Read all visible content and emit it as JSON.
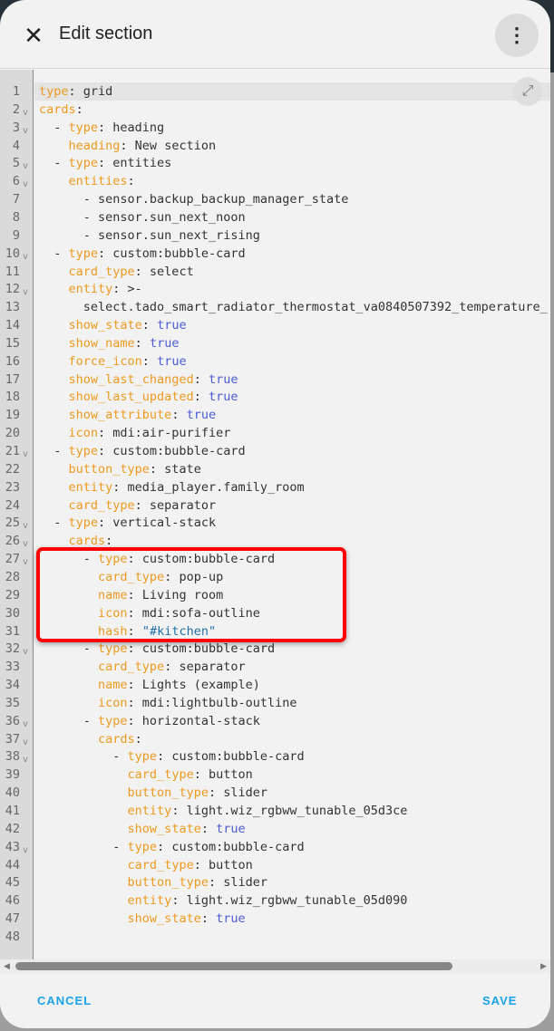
{
  "header": {
    "title": "Edit section",
    "close_icon": "close-icon",
    "menu_icon": "dots-vertical-icon"
  },
  "editor": {
    "expand_icon": "fullscreen-icon",
    "lines": [
      {
        "n": "1",
        "fold": false,
        "parts": [
          [
            "k",
            "type"
          ],
          [
            "",
            ": grid"
          ]
        ]
      },
      {
        "n": "2",
        "fold": true,
        "parts": [
          [
            "k",
            "cards"
          ],
          [
            "",
            ":"
          ]
        ]
      },
      {
        "n": "3",
        "fold": true,
        "parts": [
          [
            "",
            "  - "
          ],
          [
            "k",
            "type"
          ],
          [
            "",
            ": heading"
          ]
        ]
      },
      {
        "n": "4",
        "fold": false,
        "parts": [
          [
            "",
            "    "
          ],
          [
            "k",
            "heading"
          ],
          [
            "",
            ": New section"
          ]
        ]
      },
      {
        "n": "5",
        "fold": true,
        "parts": [
          [
            "",
            "  - "
          ],
          [
            "k",
            "type"
          ],
          [
            "",
            ": entities"
          ]
        ]
      },
      {
        "n": "6",
        "fold": true,
        "parts": [
          [
            "",
            "    "
          ],
          [
            "k",
            "entities"
          ],
          [
            "",
            ":"
          ]
        ]
      },
      {
        "n": "7",
        "fold": false,
        "parts": [
          [
            "",
            "      - sensor.backup_backup_manager_state"
          ]
        ]
      },
      {
        "n": "8",
        "fold": false,
        "parts": [
          [
            "",
            "      - sensor.sun_next_noon"
          ]
        ]
      },
      {
        "n": "9",
        "fold": false,
        "parts": [
          [
            "",
            "      - sensor.sun_next_rising"
          ]
        ]
      },
      {
        "n": "10",
        "fold": true,
        "parts": [
          [
            "",
            "  - "
          ],
          [
            "k",
            "type"
          ],
          [
            "",
            ": custom:bubble-card"
          ]
        ]
      },
      {
        "n": "11",
        "fold": false,
        "parts": [
          [
            "",
            "    "
          ],
          [
            "k",
            "card_type"
          ],
          [
            "",
            ": select"
          ]
        ]
      },
      {
        "n": "12",
        "fold": true,
        "parts": [
          [
            "",
            "    "
          ],
          [
            "k",
            "entity"
          ],
          [
            "",
            ": >-"
          ]
        ]
      },
      {
        "n": "13",
        "fold": false,
        "parts": [
          [
            "",
            "      select.tado_smart_radiator_thermostat_va0840507392_temperature_"
          ]
        ]
      },
      {
        "n": "14",
        "fold": false,
        "parts": [
          [
            "",
            "    "
          ],
          [
            "k",
            "show_state"
          ],
          [
            "",
            ": "
          ],
          [
            "b",
            "true"
          ]
        ]
      },
      {
        "n": "15",
        "fold": false,
        "parts": [
          [
            "",
            "    "
          ],
          [
            "k",
            "show_name"
          ],
          [
            "",
            ": "
          ],
          [
            "b",
            "true"
          ]
        ]
      },
      {
        "n": "16",
        "fold": false,
        "parts": [
          [
            "",
            "    "
          ],
          [
            "k",
            "force_icon"
          ],
          [
            "",
            ": "
          ],
          [
            "b",
            "true"
          ]
        ]
      },
      {
        "n": "17",
        "fold": false,
        "parts": [
          [
            "",
            "    "
          ],
          [
            "k",
            "show_last_changed"
          ],
          [
            "",
            ": "
          ],
          [
            "b",
            "true"
          ]
        ]
      },
      {
        "n": "18",
        "fold": false,
        "parts": [
          [
            "",
            "    "
          ],
          [
            "k",
            "show_last_updated"
          ],
          [
            "",
            ": "
          ],
          [
            "b",
            "true"
          ]
        ]
      },
      {
        "n": "19",
        "fold": false,
        "parts": [
          [
            "",
            "    "
          ],
          [
            "k",
            "show_attribute"
          ],
          [
            "",
            ": "
          ],
          [
            "b",
            "true"
          ]
        ]
      },
      {
        "n": "20",
        "fold": false,
        "parts": [
          [
            "",
            "    "
          ],
          [
            "k",
            "icon"
          ],
          [
            "",
            ": mdi:air-purifier"
          ]
        ]
      },
      {
        "n": "21",
        "fold": true,
        "parts": [
          [
            "",
            "  - "
          ],
          [
            "k",
            "type"
          ],
          [
            "",
            ": custom:bubble-card"
          ]
        ]
      },
      {
        "n": "22",
        "fold": false,
        "parts": [
          [
            "",
            "    "
          ],
          [
            "k",
            "button_type"
          ],
          [
            "",
            ": state"
          ]
        ]
      },
      {
        "n": "23",
        "fold": false,
        "parts": [
          [
            "",
            "    "
          ],
          [
            "k",
            "entity"
          ],
          [
            "",
            ": media_player.family_room"
          ]
        ]
      },
      {
        "n": "24",
        "fold": false,
        "parts": [
          [
            "",
            "    "
          ],
          [
            "k",
            "card_type"
          ],
          [
            "",
            ": separator"
          ]
        ]
      },
      {
        "n": "25",
        "fold": true,
        "parts": [
          [
            "",
            "  - "
          ],
          [
            "k",
            "type"
          ],
          [
            "",
            ": vertical-stack"
          ]
        ]
      },
      {
        "n": "26",
        "fold": true,
        "parts": [
          [
            "",
            "    "
          ],
          [
            "k",
            "cards"
          ],
          [
            "",
            ":"
          ]
        ]
      },
      {
        "n": "27",
        "fold": true,
        "parts": [
          [
            "",
            "      - "
          ],
          [
            "k",
            "type"
          ],
          [
            "",
            ": custom:bubble-card"
          ]
        ]
      },
      {
        "n": "28",
        "fold": false,
        "parts": [
          [
            "",
            "        "
          ],
          [
            "k",
            "card_type"
          ],
          [
            "",
            ": pop-up"
          ]
        ]
      },
      {
        "n": "29",
        "fold": false,
        "parts": [
          [
            "",
            "        "
          ],
          [
            "k",
            "name"
          ],
          [
            "",
            ": Living room"
          ]
        ]
      },
      {
        "n": "30",
        "fold": false,
        "parts": [
          [
            "",
            "        "
          ],
          [
            "k",
            "icon"
          ],
          [
            "",
            ": mdi:sofa-outline"
          ]
        ]
      },
      {
        "n": "31",
        "fold": false,
        "parts": [
          [
            "",
            "        "
          ],
          [
            "k",
            "hash"
          ],
          [
            "",
            ": "
          ],
          [
            "s",
            "\"#kitchen\""
          ]
        ]
      },
      {
        "n": "32",
        "fold": true,
        "parts": [
          [
            "",
            "      - "
          ],
          [
            "k",
            "type"
          ],
          [
            "",
            ": custom:bubble-card"
          ]
        ]
      },
      {
        "n": "33",
        "fold": false,
        "parts": [
          [
            "",
            "        "
          ],
          [
            "k",
            "card_type"
          ],
          [
            "",
            ": separator"
          ]
        ]
      },
      {
        "n": "34",
        "fold": false,
        "parts": [
          [
            "",
            "        "
          ],
          [
            "k",
            "name"
          ],
          [
            "",
            ": Lights (example)"
          ]
        ]
      },
      {
        "n": "35",
        "fold": false,
        "parts": [
          [
            "",
            "        "
          ],
          [
            "k",
            "icon"
          ],
          [
            "",
            ": mdi:lightbulb-outline"
          ]
        ]
      },
      {
        "n": "36",
        "fold": true,
        "parts": [
          [
            "",
            "      - "
          ],
          [
            "k",
            "type"
          ],
          [
            "",
            ": horizontal-stack"
          ]
        ]
      },
      {
        "n": "37",
        "fold": true,
        "parts": [
          [
            "",
            "        "
          ],
          [
            "k",
            "cards"
          ],
          [
            "",
            ":"
          ]
        ]
      },
      {
        "n": "38",
        "fold": true,
        "parts": [
          [
            "",
            "          - "
          ],
          [
            "k",
            "type"
          ],
          [
            "",
            ": custom:bubble-card"
          ]
        ]
      },
      {
        "n": "39",
        "fold": false,
        "parts": [
          [
            "",
            "            "
          ],
          [
            "k",
            "card_type"
          ],
          [
            "",
            ": button"
          ]
        ]
      },
      {
        "n": "40",
        "fold": false,
        "parts": [
          [
            "",
            "            "
          ],
          [
            "k",
            "button_type"
          ],
          [
            "",
            ": slider"
          ]
        ]
      },
      {
        "n": "41",
        "fold": false,
        "parts": [
          [
            "",
            "            "
          ],
          [
            "k",
            "entity"
          ],
          [
            "",
            ": light.wiz_rgbww_tunable_05d3ce"
          ]
        ]
      },
      {
        "n": "42",
        "fold": false,
        "parts": [
          [
            "",
            "            "
          ],
          [
            "k",
            "show_state"
          ],
          [
            "",
            ": "
          ],
          [
            "b",
            "true"
          ]
        ]
      },
      {
        "n": "43",
        "fold": true,
        "parts": [
          [
            "",
            "          - "
          ],
          [
            "k",
            "type"
          ],
          [
            "",
            ": custom:bubble-card"
          ]
        ]
      },
      {
        "n": "44",
        "fold": false,
        "parts": [
          [
            "",
            "            "
          ],
          [
            "k",
            "card_type"
          ],
          [
            "",
            ": button"
          ]
        ]
      },
      {
        "n": "45",
        "fold": false,
        "parts": [
          [
            "",
            "            "
          ],
          [
            "k",
            "button_type"
          ],
          [
            "",
            ": slider"
          ]
        ]
      },
      {
        "n": "46",
        "fold": false,
        "parts": [
          [
            "",
            "            "
          ],
          [
            "k",
            "entity"
          ],
          [
            "",
            ": light.wiz_rgbww_tunable_05d090"
          ]
        ]
      },
      {
        "n": "47",
        "fold": false,
        "parts": [
          [
            "",
            "            "
          ],
          [
            "k",
            "show_state"
          ],
          [
            "",
            ": "
          ],
          [
            "b",
            "true"
          ]
        ]
      },
      {
        "n": "48",
        "fold": false,
        "parts": []
      }
    ]
  },
  "footer": {
    "cancel": "CANCEL",
    "save": "SAVE"
  },
  "colors": {
    "key": "#ed9a1e",
    "bool": "#4a5bd4",
    "string": "#1f70a8",
    "accent": "#1aa3e8",
    "highlight": "#ff0000"
  }
}
